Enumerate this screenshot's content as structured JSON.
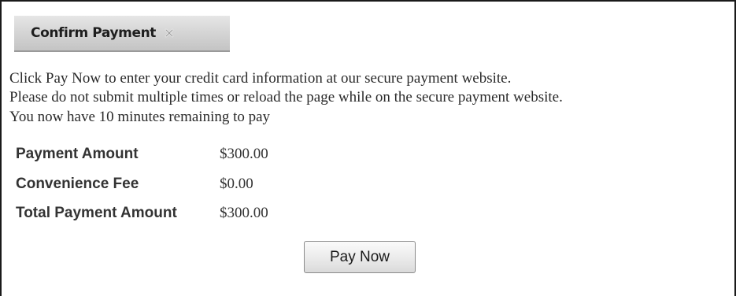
{
  "dialog": {
    "tab_title": "Confirm Payment",
    "close_icon": "close-icon"
  },
  "messages": [
    "Click Pay Now to enter your credit card information at our secure payment website.",
    "Please do not submit multiple times or reload the page while on the secure payment website.",
    "You now have 10 minutes remaining to pay"
  ],
  "summary": [
    {
      "label": "Payment Amount",
      "value": "$300.00"
    },
    {
      "label": "Convenience Fee",
      "value": "$0.00"
    },
    {
      "label": "Total Payment Amount",
      "value": "$300.00"
    }
  ],
  "actions": {
    "pay_now_label": "Pay Now"
  }
}
